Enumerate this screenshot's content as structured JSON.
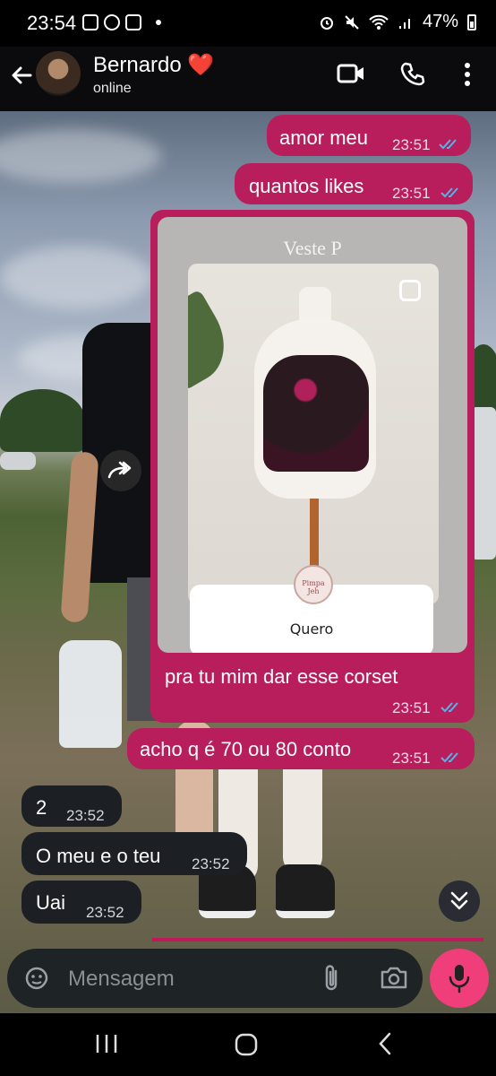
{
  "status_bar": {
    "time": "23:54",
    "battery": "47%"
  },
  "header": {
    "name": "Bernardo",
    "heart": "❤️",
    "status": "online"
  },
  "messages": {
    "m1": {
      "text": "amor meu",
      "time": "23:51"
    },
    "m2": {
      "text": "quantos likes",
      "time": "23:51"
    },
    "story": {
      "caption": "Veste P",
      "sticker_text": "Quero",
      "sticker_logo_text": "Pimpa Jeh"
    },
    "m3": {
      "text": "pra tu mim dar esse corset",
      "time": "23:51"
    },
    "m4": {
      "text": "acho q é 70 ou 80 conto",
      "time": "23:51"
    },
    "m5": {
      "text": "2",
      "time": "23:52"
    },
    "m6": {
      "text": "O meu e o teu",
      "time": "23:52"
    },
    "m7": {
      "text": "Uai",
      "time": "23:52"
    }
  },
  "composer": {
    "placeholder": "Mensagem"
  },
  "colors": {
    "outgoing": "#b81e5c",
    "incoming": "#1c2024",
    "mic": "#ef3e7a",
    "read_ticks": "#4fb6ec"
  },
  "icons": [
    "back-arrow-icon",
    "video-call-icon",
    "phone-icon",
    "more-vert-icon",
    "forward-icon",
    "copy-icon",
    "chevron-double-down-icon",
    "sticker-icon",
    "attach-icon",
    "camera-icon",
    "mic-icon",
    "nav-recents-icon",
    "nav-home-icon",
    "nav-back-icon"
  ]
}
